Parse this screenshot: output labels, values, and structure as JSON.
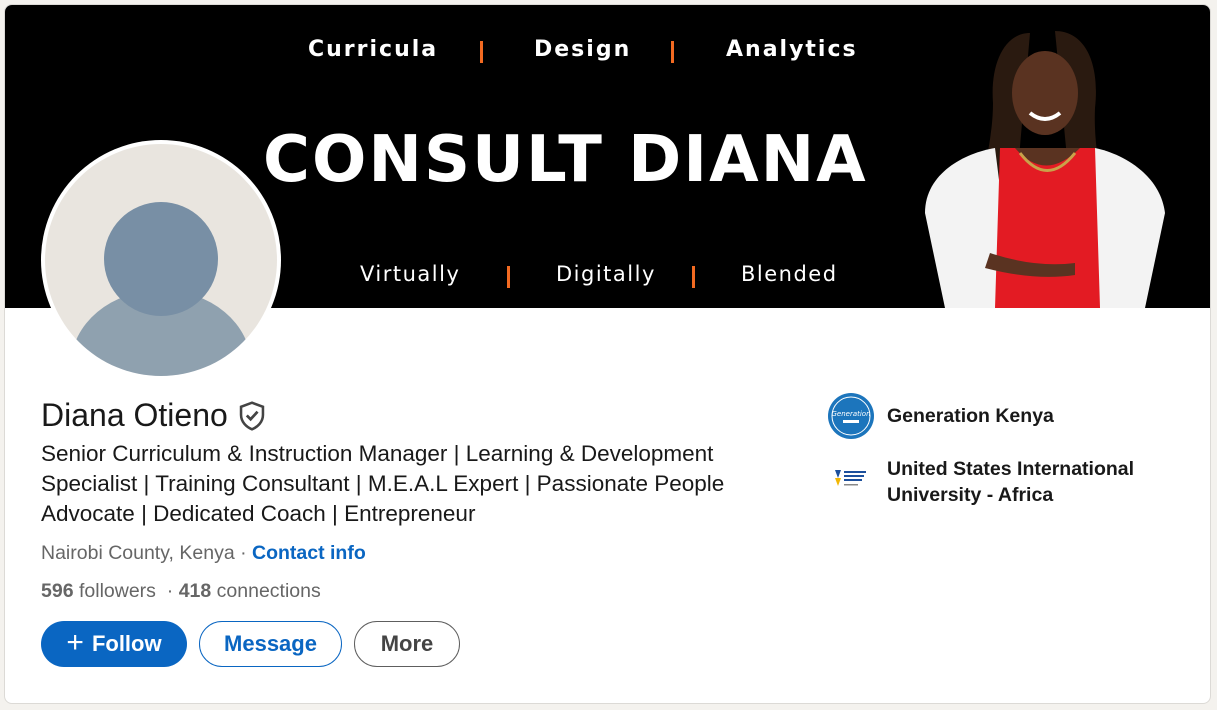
{
  "banner": {
    "top_items": [
      "Curricula",
      "Design",
      "Analytics"
    ],
    "title": "CONSULT DIANA",
    "bottom_items": [
      "Virtually",
      "Digitally",
      "Blended"
    ]
  },
  "profile": {
    "name": "Diana Otieno",
    "headline": "Senior Curriculum & Instruction Manager | Learning & Development Specialist | Training Consultant | M.E.A.L Expert | Passionate People Advocate | Dedicated Coach | Entrepreneur",
    "location": "Nairobi County, Kenya",
    "separator": "·",
    "contact_info_label": "Contact info",
    "followers_count": "596",
    "followers_label": "followers",
    "stats_separator": "·",
    "connections_count": "418",
    "connections_label": "connections"
  },
  "actions": {
    "follow_icon": "+",
    "follow_label": "Follow",
    "message_label": "Message",
    "more_label": "More"
  },
  "orgs": [
    {
      "name": "Generation Kenya",
      "icon": "generation-kenya-logo"
    },
    {
      "name": "United States International University - Africa",
      "icon": "usiu-africa-logo"
    }
  ],
  "colors": {
    "primary": "#0a66c2",
    "banner_bg": "#000000",
    "banner_accent": "#f26a21",
    "text": "#191919",
    "muted": "#666666"
  }
}
